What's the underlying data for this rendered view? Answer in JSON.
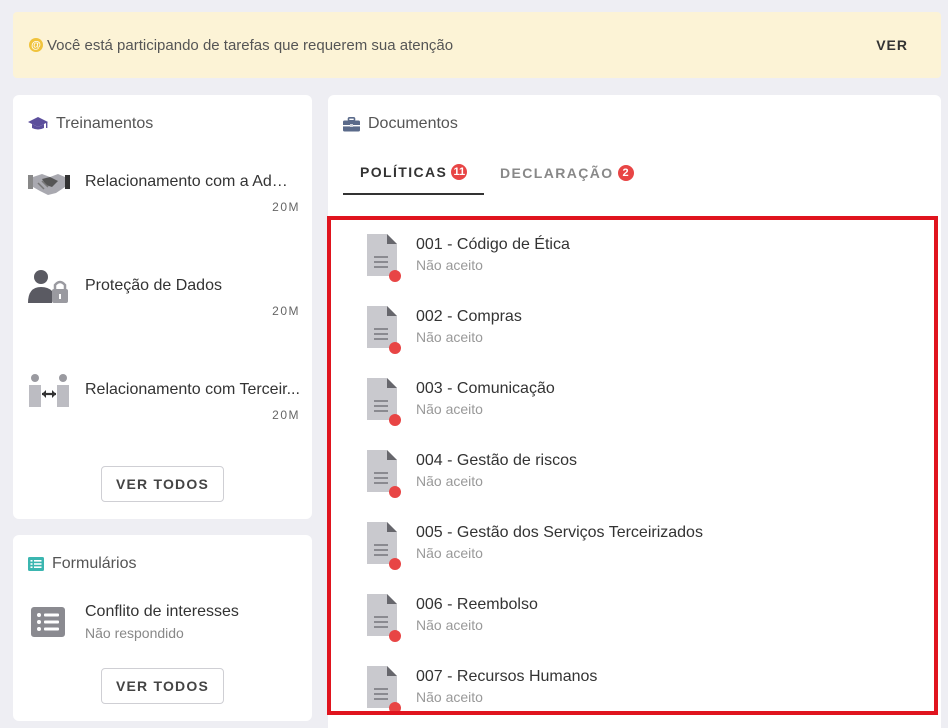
{
  "alert": {
    "icon": "@",
    "text": "Você está participando de tarefas que requerem sua atenção",
    "link": "VER",
    "color": "#f0c33c"
  },
  "training": {
    "title": "Treinamentos",
    "items": [
      {
        "name": "Relacionamento com a Adm....",
        "duration": "20M",
        "icon": "handshake-icon"
      },
      {
        "name": "Proteção de Dados",
        "duration": "20M",
        "icon": "user-lock-icon"
      },
      {
        "name": "Relacionamento com Terceir...",
        "duration": "20M",
        "icon": "people-exchange-icon"
      }
    ],
    "button": "VER TODOS"
  },
  "forms": {
    "title": "Formulários",
    "items": [
      {
        "name": "Conflito de interesses",
        "status": "Não respondido",
        "icon": "list-icon"
      }
    ],
    "button": "VER TODOS"
  },
  "documents": {
    "title": "Documentos",
    "tabs": [
      {
        "label": "POLÍTICAS",
        "badge": "11",
        "active": true
      },
      {
        "label": "DECLARAÇÃO",
        "badge": "2",
        "active": false
      }
    ],
    "items": [
      {
        "name": "001 - Código de Ética",
        "status": "Não aceito"
      },
      {
        "name": "002 - Compras",
        "status": "Não aceito"
      },
      {
        "name": "003 - Comunicação",
        "status": "Não aceito"
      },
      {
        "name": "004 - Gestão de riscos",
        "status": "Não aceito"
      },
      {
        "name": "005 - Gestão dos Serviços Terceirizados",
        "status": "Não aceito"
      },
      {
        "name": "006 - Reembolso",
        "status": "Não aceito"
      },
      {
        "name": "007 - Recursos Humanos",
        "status": "Não aceito"
      }
    ]
  },
  "colors": {
    "accent_red": "#e84545",
    "highlight_border": "#e0141e",
    "alert_bg": "#fcf3d6"
  }
}
